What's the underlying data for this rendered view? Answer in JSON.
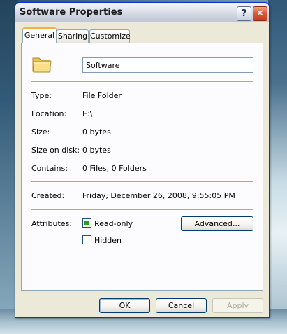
{
  "window": {
    "title": "Software Properties",
    "help_glyph": "?",
    "close_glyph": "✕"
  },
  "tabs": [
    {
      "label": "General",
      "active": true
    },
    {
      "label": "Sharing",
      "active": false
    },
    {
      "label": "Customize",
      "active": false
    }
  ],
  "general": {
    "folder_icon": "folder-icon",
    "name_value": "Software",
    "properties": [
      {
        "label": "Type:",
        "value": "File Folder"
      },
      {
        "label": "Location:",
        "value": "E:\\"
      },
      {
        "label": "Size:",
        "value": "0 bytes"
      },
      {
        "label": "Size on disk:",
        "value": "0 bytes"
      },
      {
        "label": "Contains:",
        "value": "0 Files, 0 Folders"
      }
    ],
    "created": {
      "label": "Created:",
      "value": "Friday, December 26, 2008, 9:55:05 PM"
    },
    "attributes": {
      "label": "Attributes:",
      "read_only": {
        "label": "Read-only",
        "checked": true,
        "state": "indeterminate"
      },
      "hidden": {
        "label": "Hidden",
        "checked": false
      },
      "advanced_button": "Advanced..."
    }
  },
  "buttons": {
    "ok": "OK",
    "cancel": "Cancel",
    "apply": "Apply"
  },
  "colors": {
    "titlebar": "#cdd3df",
    "window_bg": "#ece9d8",
    "panel_bg": "#fcfcfe",
    "close_red": "#e0593a",
    "tab_highlight": "#f3b13f",
    "checkbox_fill": "#21a121"
  }
}
